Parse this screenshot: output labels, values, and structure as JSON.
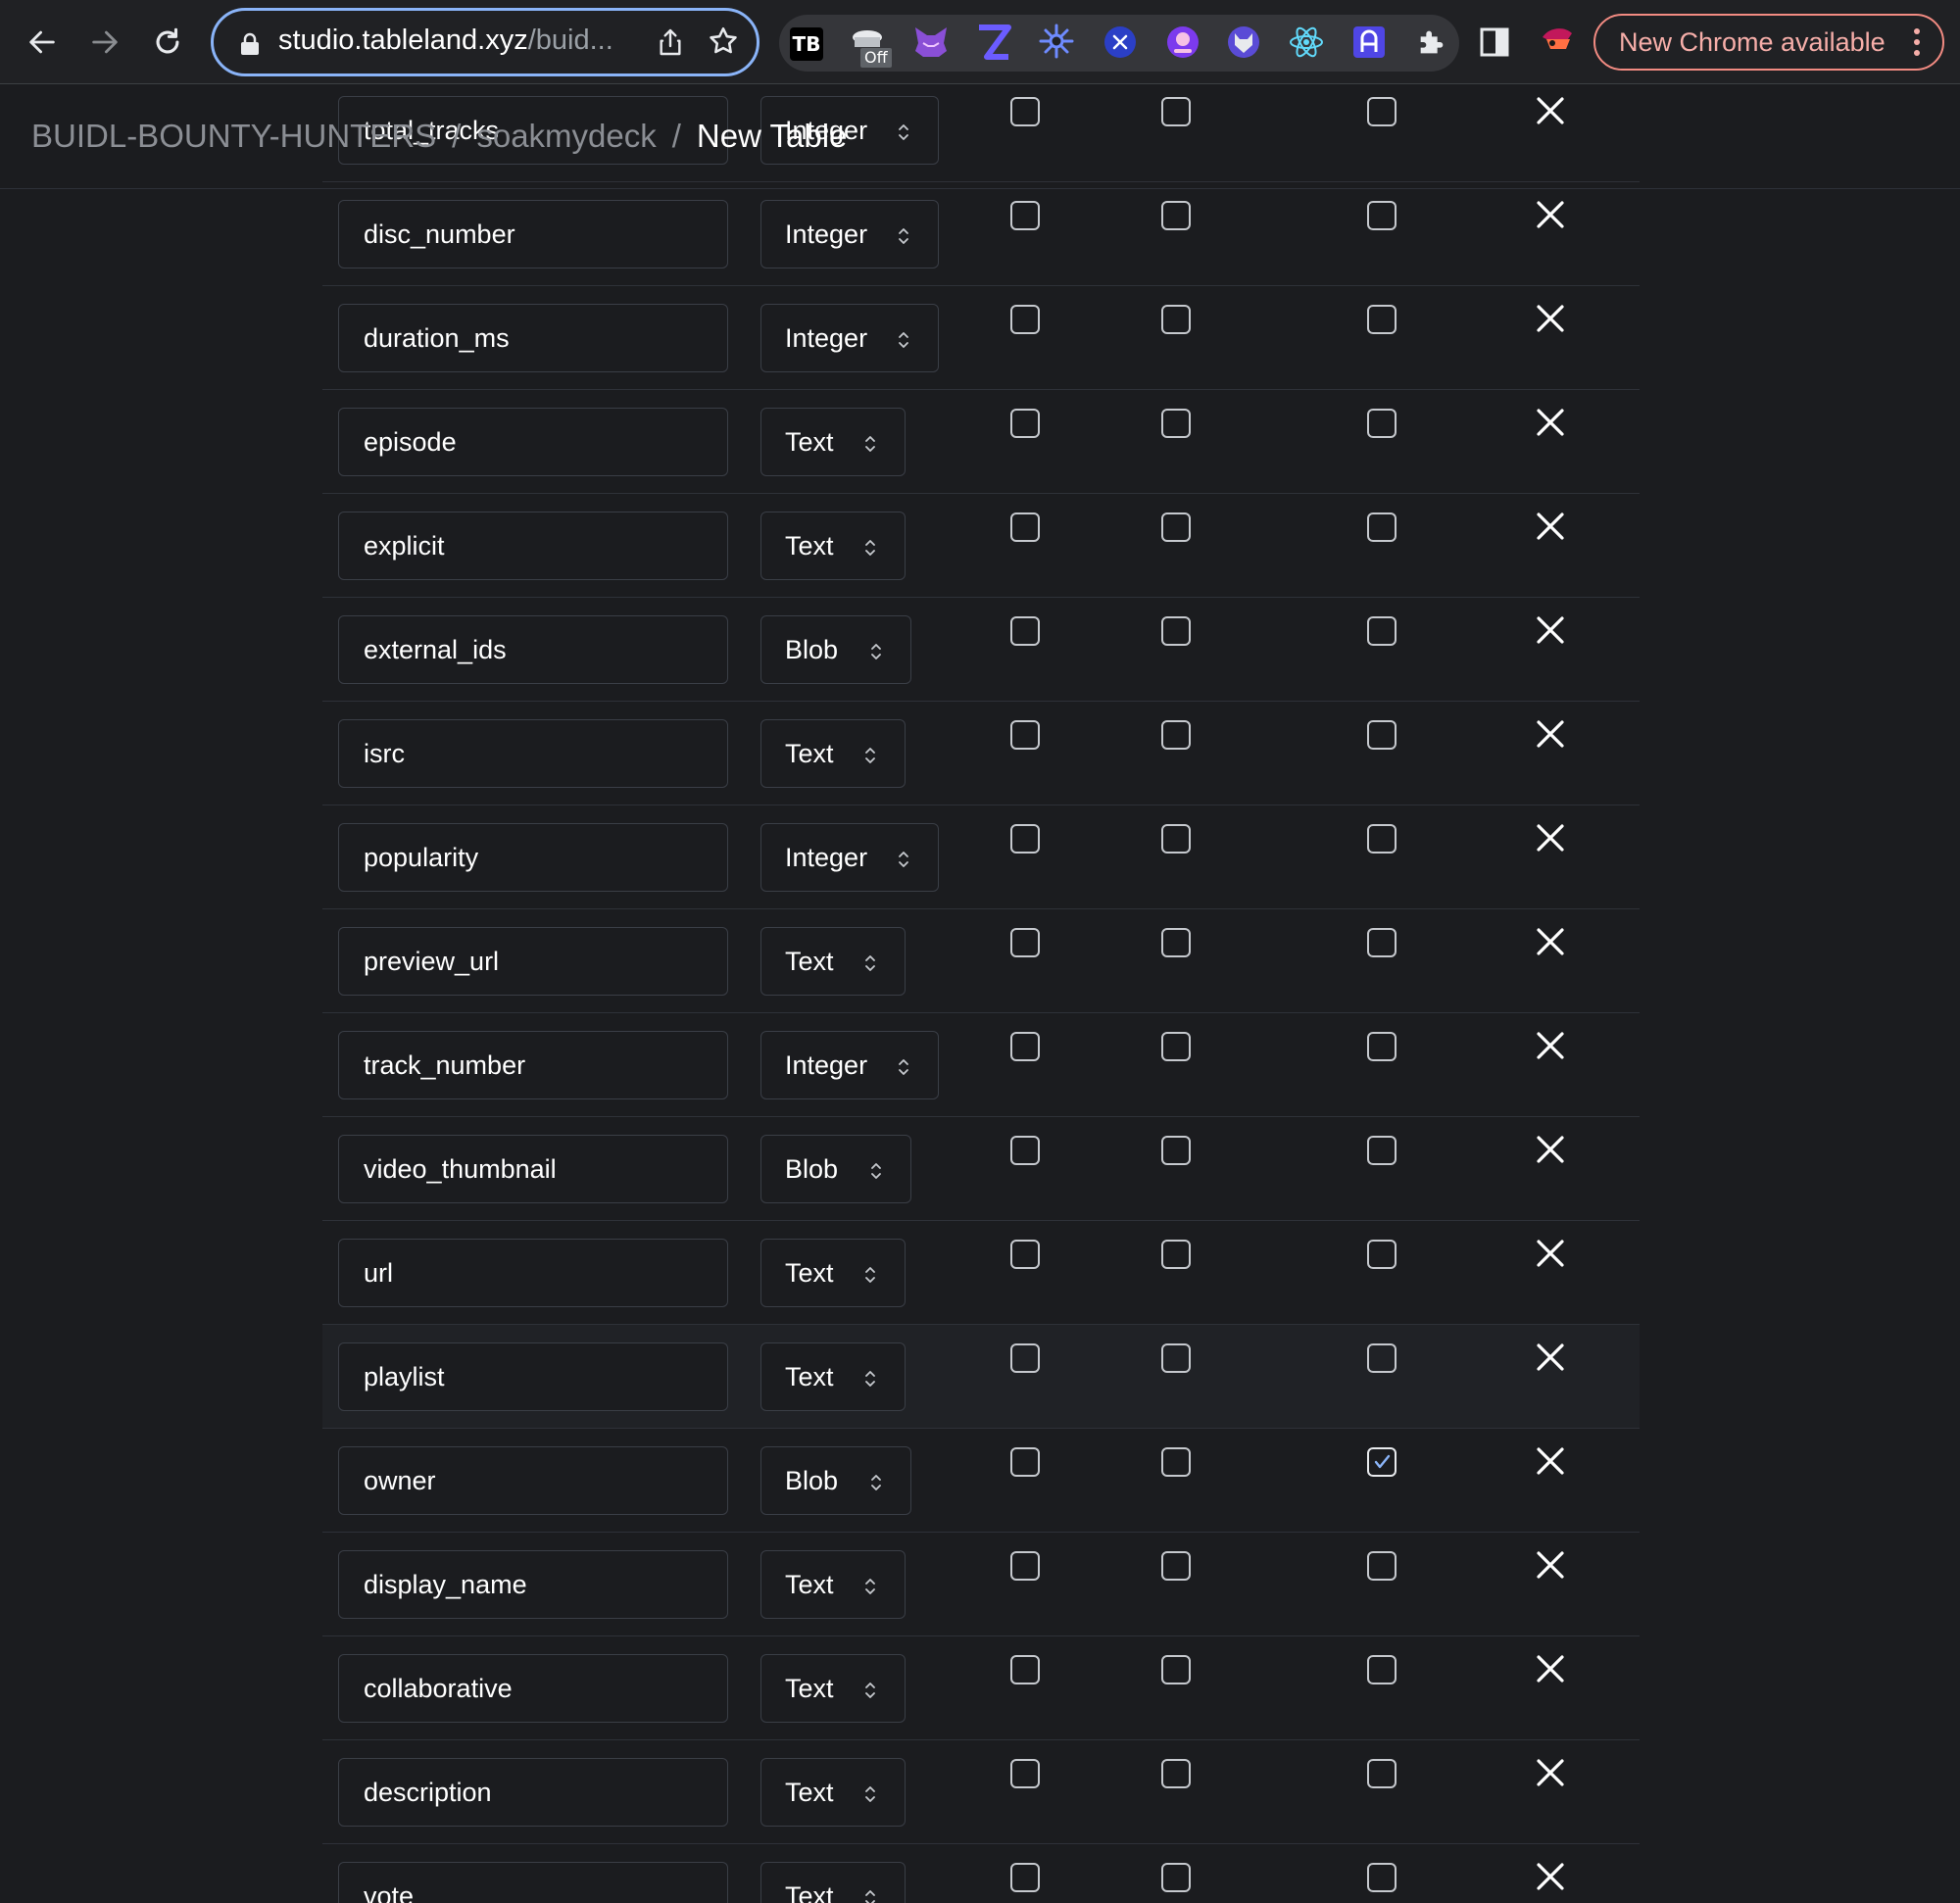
{
  "browser": {
    "url_host": "studio.tableland.xyz",
    "url_path": "/buid...",
    "extensions": {
      "tb_label": "TB",
      "off_badge": "Off"
    },
    "update_label": "New Chrome available"
  },
  "breadcrumb": {
    "org": "BUIDL-BOUNTY-HUNTERS",
    "separator": "/",
    "project": "soakmydeck",
    "current": "New Table"
  },
  "columns": [
    {
      "name": "total_tracks",
      "type": "Integer",
      "opt1": false,
      "opt2": false,
      "opt3": false
    },
    {
      "name": "disc_number",
      "type": "Integer",
      "opt1": false,
      "opt2": false,
      "opt3": false
    },
    {
      "name": "duration_ms",
      "type": "Integer",
      "opt1": false,
      "opt2": false,
      "opt3": false
    },
    {
      "name": "episode",
      "type": "Text",
      "opt1": false,
      "opt2": false,
      "opt3": false
    },
    {
      "name": "explicit",
      "type": "Text",
      "opt1": false,
      "opt2": false,
      "opt3": false
    },
    {
      "name": "external_ids",
      "type": "Blob",
      "opt1": false,
      "opt2": false,
      "opt3": false
    },
    {
      "name": "isrc",
      "type": "Text",
      "opt1": false,
      "opt2": false,
      "opt3": false
    },
    {
      "name": "popularity",
      "type": "Integer",
      "opt1": false,
      "opt2": false,
      "opt3": false
    },
    {
      "name": "preview_url",
      "type": "Text",
      "opt1": false,
      "opt2": false,
      "opt3": false
    },
    {
      "name": "track_number",
      "type": "Integer",
      "opt1": false,
      "opt2": false,
      "opt3": false
    },
    {
      "name": "video_thumbnail",
      "type": "Blob",
      "opt1": false,
      "opt2": false,
      "opt3": false
    },
    {
      "name": "url",
      "type": "Text",
      "opt1": false,
      "opt2": false,
      "opt3": false
    },
    {
      "name": "playlist",
      "type": "Text",
      "opt1": false,
      "opt2": false,
      "opt3": false,
      "highlighted": true
    },
    {
      "name": "owner",
      "type": "Blob",
      "opt1": false,
      "opt2": false,
      "opt3": true
    },
    {
      "name": "display_name",
      "type": "Text",
      "opt1": false,
      "opt2": false,
      "opt3": false
    },
    {
      "name": "collaborative",
      "type": "Text",
      "opt1": false,
      "opt2": false,
      "opt3": false
    },
    {
      "name": "description",
      "type": "Text",
      "opt1": false,
      "opt2": false,
      "opt3": false
    },
    {
      "name": "vote",
      "type": "Text",
      "opt1": false,
      "opt2": false,
      "opt3": false
    }
  ],
  "icons": {
    "delete": "close-icon",
    "select_chevron": "chevron-up-down-icon"
  },
  "colors": {
    "page_background": "#1b1c1f",
    "omnibox_focus": "#8ab4f8",
    "update_button": "#f28b82"
  }
}
